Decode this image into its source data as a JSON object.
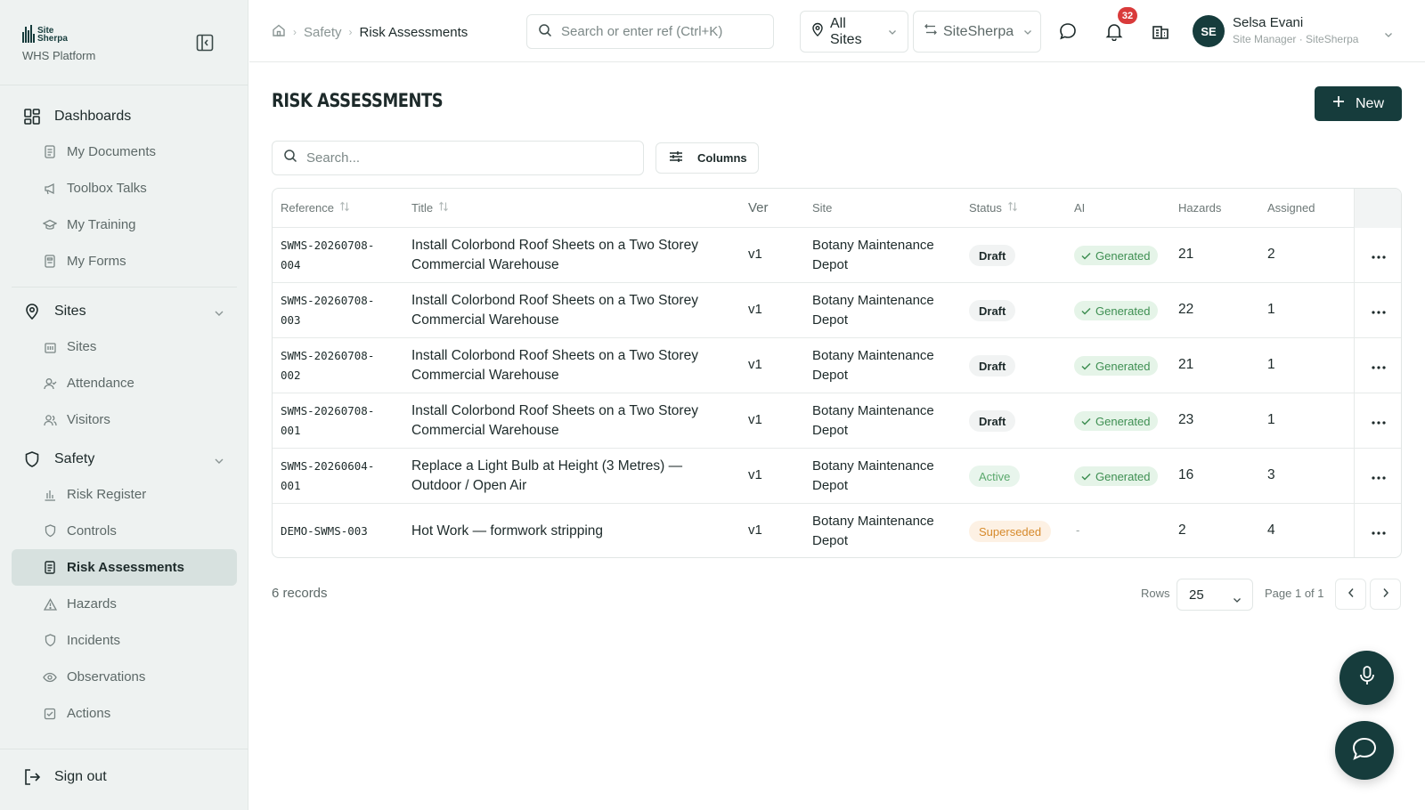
{
  "brand": {
    "wordmark_line1": "Site",
    "wordmark_line2": "Sherpa",
    "subtitle": "WHS Platform"
  },
  "sidebar": {
    "dashboards": {
      "label": "Dashboards",
      "icon": "grid-icon",
      "items": [
        {
          "label": "My Documents",
          "icon": "document-icon"
        },
        {
          "label": "Toolbox Talks",
          "icon": "megaphone-icon"
        },
        {
          "label": "My Training",
          "icon": "graduation-cap-icon"
        },
        {
          "label": "My Forms",
          "icon": "form-icon"
        }
      ]
    },
    "sites": {
      "label": "Sites",
      "icon": "map-pin-icon",
      "items": [
        {
          "label": "Sites",
          "icon": "building-icon"
        },
        {
          "label": "Attendance",
          "icon": "user-check-icon"
        },
        {
          "label": "Visitors",
          "icon": "users-icon"
        }
      ]
    },
    "safety": {
      "label": "Safety",
      "icon": "shield-icon",
      "items": [
        {
          "label": "Risk Register",
          "icon": "bar-chart-icon"
        },
        {
          "label": "Controls",
          "icon": "shield-icon"
        },
        {
          "label": "Risk Assessments",
          "icon": "document-icon",
          "active": true
        },
        {
          "label": "Hazards",
          "icon": "warning-icon"
        },
        {
          "label": "Incidents",
          "icon": "shield-icon"
        },
        {
          "label": "Observations",
          "icon": "eye-icon"
        },
        {
          "label": "Actions",
          "icon": "checkbox-icon"
        }
      ]
    },
    "signout": "Sign out"
  },
  "topbar": {
    "breadcrumb": [
      "Safety",
      "Risk Assessments"
    ],
    "search_placeholder": "Search or enter ref (Ctrl+K)",
    "site_filter": "All Sites",
    "org_switcher": "SiteSherpa",
    "notifications_count": "32",
    "user": {
      "initials": "SE",
      "name": "Selsa Evani",
      "role": "Site Manager · SiteSherpa"
    }
  },
  "main": {
    "title": "RISK ASSESSMENTS",
    "new_label": "New",
    "search_placeholder": "Search...",
    "columns_label": "Columns",
    "headers": {
      "reference": "Reference",
      "title": "Title",
      "ver": "Ver",
      "site": "Site",
      "status": "Status",
      "ai": "AI",
      "hazards": "Hazards",
      "assigned": "Assigned"
    },
    "rows": [
      {
        "ref1": "SWMS-20260708-",
        "ref2": "004",
        "title1": "Install Colorbond Roof Sheets on a Two Storey",
        "title2": "Commercial Warehouse",
        "ver": "v1",
        "site1": "Botany Maintenance",
        "site2": "Depot",
        "status": "Draft",
        "ai": "Generated",
        "hazards": "21",
        "assigned": "2"
      },
      {
        "ref1": "SWMS-20260708-",
        "ref2": "003",
        "title1": "Install Colorbond Roof Sheets on a Two Storey",
        "title2": "Commercial Warehouse",
        "ver": "v1",
        "site1": "Botany Maintenance",
        "site2": "Depot",
        "status": "Draft",
        "ai": "Generated",
        "hazards": "22",
        "assigned": "1"
      },
      {
        "ref1": "SWMS-20260708-",
        "ref2": "002",
        "title1": "Install Colorbond Roof Sheets on a Two Storey",
        "title2": "Commercial Warehouse",
        "ver": "v1",
        "site1": "Botany Maintenance",
        "site2": "Depot",
        "status": "Draft",
        "ai": "Generated",
        "hazards": "21",
        "assigned": "1"
      },
      {
        "ref1": "SWMS-20260708-",
        "ref2": "001",
        "title1": "Install Colorbond Roof Sheets on a Two Storey",
        "title2": "Commercial Warehouse",
        "ver": "v1",
        "site1": "Botany Maintenance",
        "site2": "Depot",
        "status": "Draft",
        "ai": "Generated",
        "hazards": "23",
        "assigned": "1"
      },
      {
        "ref1": "SWMS-20260604-",
        "ref2": "001",
        "title1": "Replace a Light Bulb at Height (3 Metres) —",
        "title2": "Outdoor / Open Air",
        "ver": "v1",
        "site1": "Botany Maintenance",
        "site2": "Depot",
        "status": "Active",
        "ai": "Generated",
        "hazards": "16",
        "assigned": "3"
      },
      {
        "ref1": "DEMO-SWMS-003",
        "ref2": "",
        "title1": "Hot Work — formwork stripping",
        "title2": "",
        "ver": "v1",
        "site1": "Botany Maintenance",
        "site2": "Depot",
        "status": "Superseded",
        "ai": "-",
        "hazards": "2",
        "assigned": "4"
      }
    ],
    "records_label": "6 records",
    "rows_label": "Rows",
    "rows_value": "25",
    "page_label": "Page 1 of 1"
  },
  "colors": {
    "brand_dark": "#163c3c",
    "sidebar_bg": "#eef2f1",
    "badge_red": "#d93a3a",
    "generated_green": "#3e8f52",
    "superseded_orange": "#d68a2c"
  }
}
